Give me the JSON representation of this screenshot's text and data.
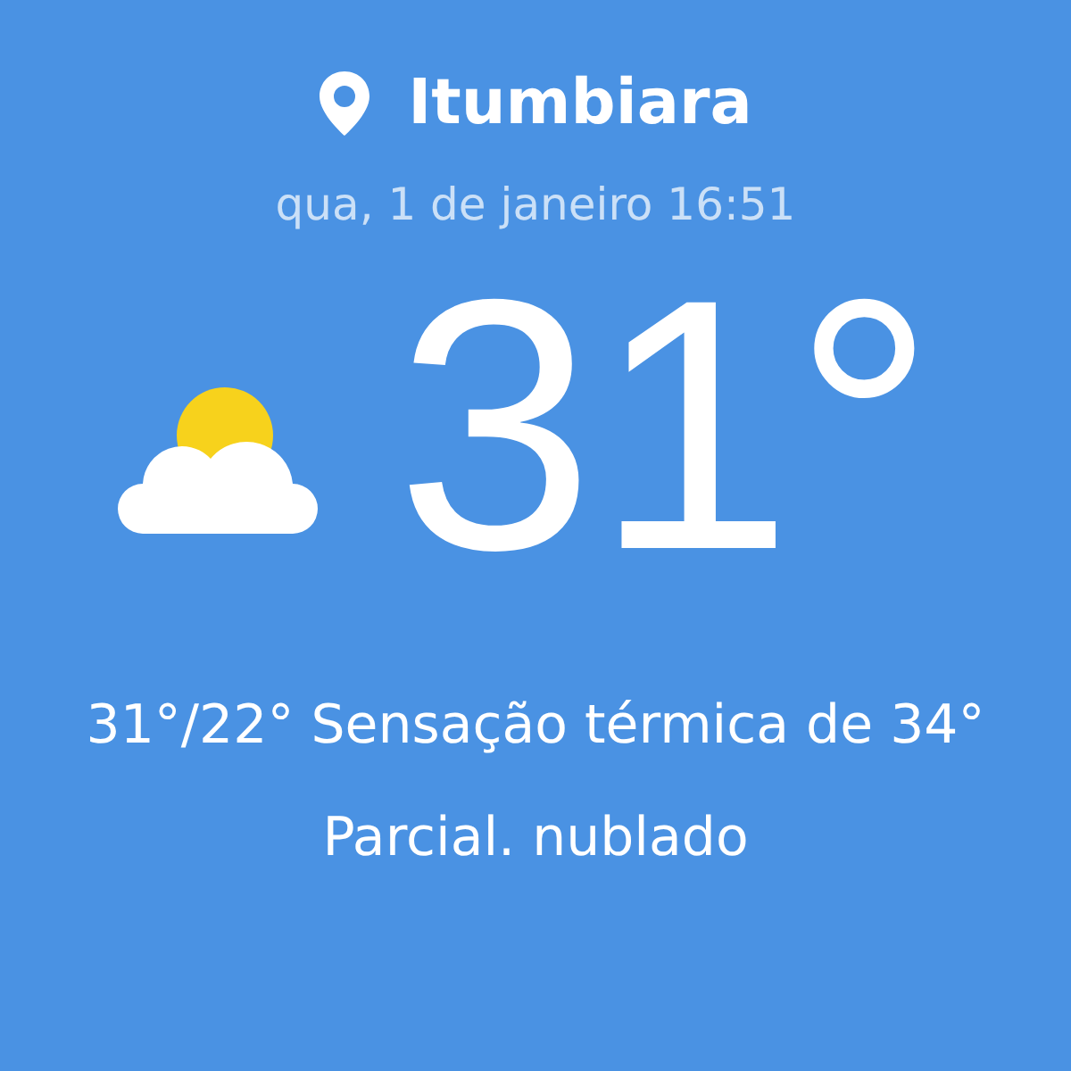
{
  "location": {
    "name": "Itumbiara"
  },
  "datetime": "qua, 1 de janeiro 16:51",
  "current": {
    "temperature": "31°",
    "summary": "31°/22° Sensação térmica de 34°",
    "condition": "Parcial. nublado"
  }
}
